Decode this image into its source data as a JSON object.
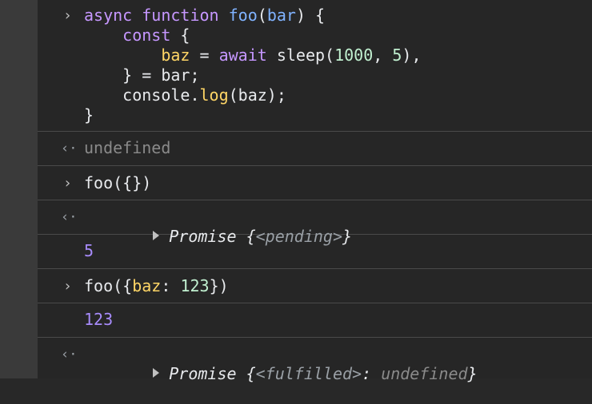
{
  "entries": [
    {
      "kind": "input",
      "lines": [
        [
          {
            "t": "async",
            "c": "kw"
          },
          {
            "t": " "
          },
          {
            "t": "function",
            "c": "kw"
          },
          {
            "t": " "
          },
          {
            "t": "foo",
            "c": "fn"
          },
          {
            "t": "("
          },
          {
            "t": "bar",
            "c": "fn"
          },
          {
            "t": ") {"
          }
        ],
        [
          {
            "t": "    "
          },
          {
            "t": "const",
            "c": "kw"
          },
          {
            "t": " {"
          }
        ],
        [
          {
            "t": "        "
          },
          {
            "t": "baz",
            "c": "prop"
          },
          {
            "t": " = "
          },
          {
            "t": "await",
            "c": "kw"
          },
          {
            "t": " sleep("
          },
          {
            "t": "1000",
            "c": "num"
          },
          {
            "t": ", "
          },
          {
            "t": "5",
            "c": "num"
          },
          {
            "t": "),"
          }
        ],
        [
          {
            "t": "    } = bar;"
          }
        ],
        [
          {
            "t": "    console."
          },
          {
            "t": "log",
            "c": "prop"
          },
          {
            "t": "(baz);"
          }
        ],
        [
          {
            "t": "}"
          }
        ]
      ]
    },
    {
      "kind": "result",
      "text": "undefined"
    },
    {
      "kind": "input",
      "lines": [
        [
          {
            "t": "foo({})"
          }
        ]
      ]
    },
    {
      "kind": "result-promise",
      "label": "Promise",
      "open": "{",
      "state": "<pending>",
      "close": "}"
    },
    {
      "kind": "log-number",
      "text": "5"
    },
    {
      "kind": "input",
      "lines": [
        [
          {
            "t": "foo({"
          },
          {
            "t": "baz",
            "c": "prop"
          },
          {
            "t": ": "
          },
          {
            "t": "123",
            "c": "num"
          },
          {
            "t": "})"
          }
        ]
      ]
    },
    {
      "kind": "log-number",
      "text": "123"
    },
    {
      "kind": "result-promise-full",
      "label": "Promise",
      "open": "{",
      "state": "<fulfilled>",
      "sep": ": ",
      "value": "undefined",
      "close": "}"
    }
  ],
  "symbols": {
    "input_prompt": "›",
    "result_prompt": "‹·"
  }
}
